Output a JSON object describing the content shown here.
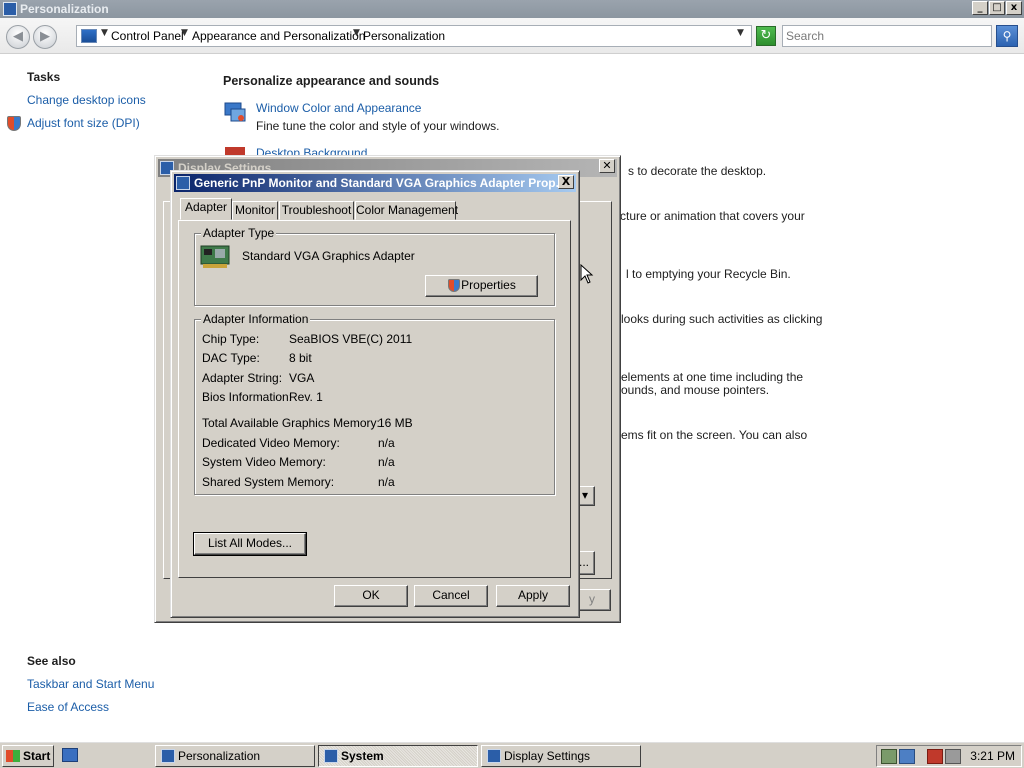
{
  "window": {
    "title": "Personalization",
    "controls": {
      "minimize": "_",
      "maximize": "□",
      "close": "x"
    }
  },
  "nav": {
    "back_glyph": "◀",
    "forward_glyph": "▶",
    "breadcrumb": [
      "Control Panel",
      "Appearance and Personalization",
      "Personalization"
    ],
    "search_placeholder": "Search",
    "refresh_glyph": "↻",
    "search_glyph": "⚲"
  },
  "tasks": {
    "heading": "Tasks",
    "links": [
      "Change desktop icons",
      "Adjust font size (DPI)"
    ]
  },
  "see_also": {
    "heading": "See also",
    "links": [
      "Taskbar and Start Menu",
      "Ease of Access"
    ]
  },
  "main": {
    "title": "Personalize appearance and sounds",
    "item1_link": "Window Color and Appearance",
    "item1_desc": "Fine tune the color and style of your windows.",
    "item2_link": "Desktop Background",
    "item2_desc_fragment": "s to decorate the desktop.",
    "item3_desc_fragment": "cture or animation that covers your",
    "item4_desc_fragment": "l to emptying your Recycle Bin.",
    "item5_desc_fragment": "looks during such activities as clicking",
    "item6_desc_fragment_1": "elements at one time including the",
    "item6_desc_fragment_2": "ounds, and mouse pointers.",
    "item7_desc_fragment": "ems fit on the screen. You can also"
  },
  "display_settings_dialog": {
    "title": "Display Settings",
    "ellipsis_button": "...",
    "dropdown_glyph": "▾",
    "apply_fragment": "y"
  },
  "properties_dialog": {
    "title": "Generic PnP Monitor and Standard VGA Graphics Adapter Prop...",
    "close": "X",
    "tabs": [
      "Adapter",
      "Monitor",
      "Troubleshoot",
      "Color Management"
    ],
    "adapter_type": {
      "label": "Adapter Type",
      "value": "Standard VGA Graphics Adapter",
      "properties_button": "Properties"
    },
    "adapter_info": {
      "label": "Adapter Information",
      "rows": [
        {
          "key": "Chip Type:",
          "value": "SeaBIOS VBE(C) 2011"
        },
        {
          "key": "DAC Type:",
          "value": "8 bit"
        },
        {
          "key": "Adapter String:",
          "value": "VGA"
        },
        {
          "key": "Bios Information:",
          "value": "Rev. 1"
        }
      ],
      "memory_rows": [
        {
          "key": "Total Available Graphics Memory:",
          "value": "16 MB"
        },
        {
          "key": "Dedicated Video Memory:",
          "value": "n/a"
        },
        {
          "key": "System Video Memory:",
          "value": "n/a"
        },
        {
          "key": "Shared System Memory:",
          "value": "n/a"
        }
      ]
    },
    "list_modes_button": "List All Modes...",
    "ok": "OK",
    "cancel": "Cancel",
    "apply": "Apply"
  },
  "taskbar": {
    "start": "Start",
    "tasks": [
      "Personalization",
      "System",
      "Display Settings"
    ],
    "clock": "3:21 PM"
  }
}
